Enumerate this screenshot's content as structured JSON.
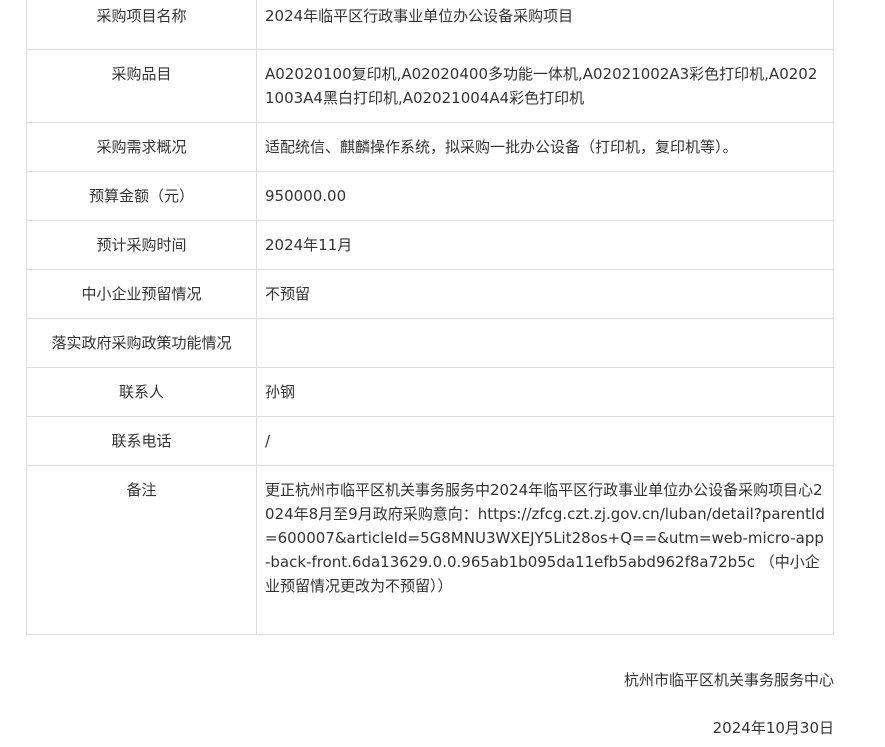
{
  "rows": [
    {
      "label": "采购项目名称",
      "value": "2024年临平区行政事业单位办公设备采购项目"
    },
    {
      "label": "采购品目",
      "value": "A02020100复印机,A02020400多功能一体机,A02021002A3彩色打印机,A02021003A4黑白打印机,A02021004A4彩色打印机"
    },
    {
      "label": "采购需求概况",
      "value": "适配统信、麒麟操作系统，拟采购一批办公设备（打印机，复印机等）。"
    },
    {
      "label": "预算金额（元）",
      "value": "950000.00"
    },
    {
      "label": "预计采购时间",
      "value": "2024年11月"
    },
    {
      "label": "中小企业预留情况",
      "value": "不预留"
    },
    {
      "label": "落实政府采购政策功能情况",
      "value": ""
    },
    {
      "label": "联系人",
      "value": "孙钢"
    },
    {
      "label": "联系电话",
      "value": "/"
    },
    {
      "label": "备注",
      "value": "更正杭州市临平区机关事务服务中2024年临平区行政事业单位办公设备采购项目心2024年8月至9月政府采购意向：https://zfcg.czt.zj.gov.cn/luban/detail?parentId=600007&articleId=5G8MNU3WXEJY5Lit28os+Q==&utm=web-micro-app-back-front.6da13629.0.0.965ab1b095da11efb5abd962f8a72b5c （中小企业预留情况更改为不预留））"
    }
  ],
  "footer": {
    "organization": "杭州市临平区机关事务服务中心",
    "date": "2024年10月30日"
  }
}
